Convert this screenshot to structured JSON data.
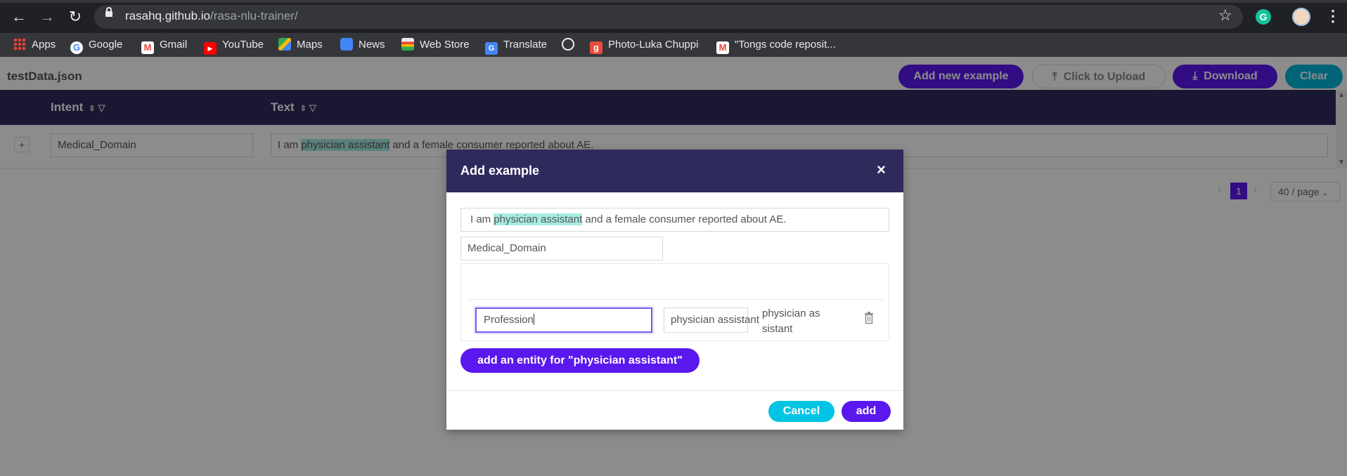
{
  "browser": {
    "url_host": "rasahq.github.io",
    "url_path": "/rasa-nlu-trainer/",
    "bookmarks": [
      {
        "label": "Apps",
        "icon": "apps-grid-icon"
      },
      {
        "label": "Google",
        "icon": "google-icon"
      },
      {
        "label": "Gmail",
        "icon": "gmail-icon"
      },
      {
        "label": "YouTube",
        "icon": "youtube-icon"
      },
      {
        "label": "Maps",
        "icon": "maps-icon"
      },
      {
        "label": "News",
        "icon": "news-icon"
      },
      {
        "label": "Web Store",
        "icon": "webstore-icon"
      },
      {
        "label": "Translate",
        "icon": "translate-icon"
      },
      {
        "label": "",
        "icon": "globe-icon"
      },
      {
        "label": "Photo-Luka Chuppi",
        "icon": "g-letter-icon"
      },
      {
        "label": "\"Tongs code reposit...",
        "icon": "gmail-icon"
      }
    ],
    "extension_letter": "G"
  },
  "app": {
    "file_title": "testData.json",
    "buttons": {
      "add_new_example": "Add new example",
      "upload": "Click to Upload",
      "download": "Download",
      "clear": "Clear"
    },
    "table": {
      "columns": [
        "Intent",
        "Text"
      ],
      "rows": [
        {
          "intent": "Medical_Domain",
          "text_before": "I am ",
          "text_entity": "physician assistant",
          "text_after": " and a female consumer reported about AE."
        }
      ],
      "expander": "+"
    },
    "pagination": {
      "current_page": "1",
      "page_size": "40 / page"
    }
  },
  "modal": {
    "title": "Add example",
    "close": "×",
    "text_before": "I am ",
    "text_entity": "physician assistant",
    "text_after": " and a female consumer reported about AE.",
    "intent": "Medical_Domain",
    "entity": {
      "name": "Profession",
      "value": "physician assistant",
      "raw_line1": "physician as",
      "raw_line2": "sistant"
    },
    "add_entity_button": "add an entity for \"physician assistant\"",
    "cancel": "Cancel",
    "add": "add"
  },
  "colors": {
    "header_dark": "#2e2a5c",
    "accent_purple": "#5a17ee",
    "accent_teal": "#00b5d8",
    "entity_highlight": "#a6ece3"
  }
}
